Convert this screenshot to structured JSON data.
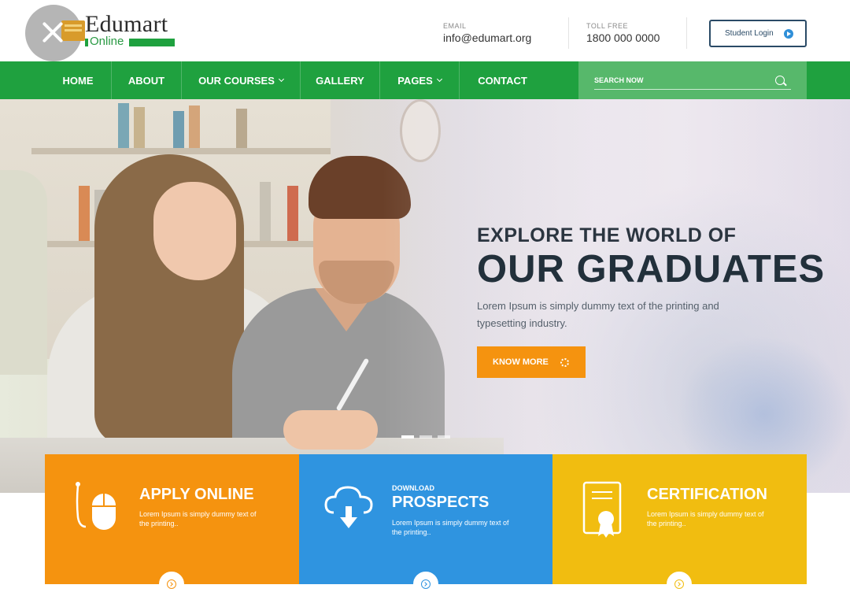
{
  "header": {
    "logo_name": "Edumart",
    "logo_sub": "Online",
    "email_label": "EMAIL",
    "email_value": "info@edumart.org",
    "phone_label": "TOLL FREE",
    "phone_value": "1800 000 0000",
    "login_label": "Student Login"
  },
  "nav": {
    "items": [
      {
        "label": "HOME"
      },
      {
        "label": "ABOUT"
      },
      {
        "label": "OUR COURSES"
      },
      {
        "label": "GALLERY"
      },
      {
        "label": "PAGES"
      },
      {
        "label": "CONTACT"
      }
    ],
    "search_placeholder": "SEARCH NOW"
  },
  "hero": {
    "subtitle": "EXPLORE THE WORLD OF",
    "title": "OUR GRADUATES",
    "description": "Lorem Ipsum is simply dummy text of the printing and typesetting industry.",
    "cta_label": "KNOW MORE"
  },
  "features": [
    {
      "title": "APPLY ONLINE",
      "description": "Lorem Ipsum is simply dummy text of the printing..",
      "color": "#f5930f",
      "icon": "mouse-icon"
    },
    {
      "kicker": "DOWNLOAD",
      "title": "PROSPECTS",
      "description": "Lorem Ipsum is simply dummy text of the printing..",
      "color": "#2f94e0",
      "icon": "cloud-download-icon"
    },
    {
      "title": "CERTIFICATION",
      "description": "Lorem Ipsum is simply dummy text of the printing..",
      "color": "#f1bd10",
      "icon": "certificate-icon"
    }
  ],
  "colors": {
    "brand_green": "#1fa13f",
    "accent_orange": "#f5930f",
    "accent_blue": "#2f94e0",
    "accent_yellow": "#f1bd10"
  }
}
